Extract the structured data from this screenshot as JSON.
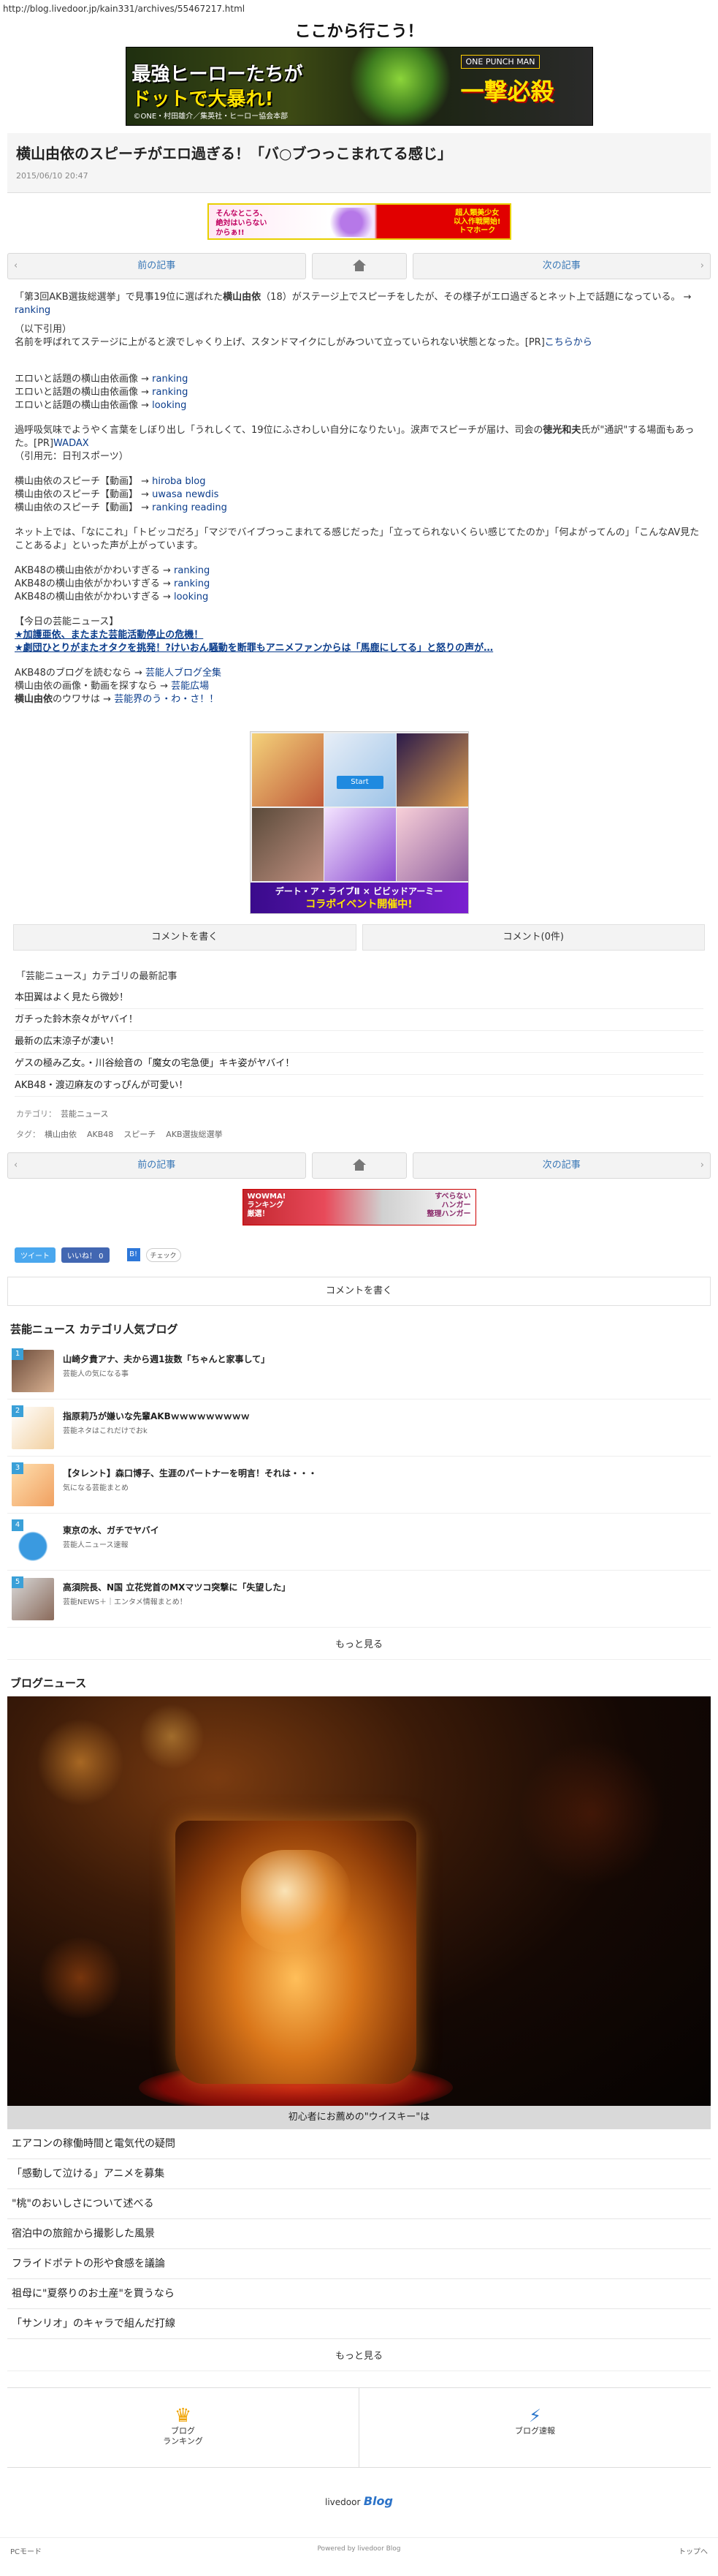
{
  "browser": {
    "url": "http://blog.livedoor.jp/kain331/archives/55467217.html"
  },
  "site": {
    "title": "ここから行こう！"
  },
  "banner": {
    "line1a": "最強ヒーローたちが",
    "line2a": "ドットで大暴れ!",
    "credit": "©ONE・村田雄介／集英社・ヒーロー協会本部",
    "brand": "ONE PUNCH MAN",
    "logo": "一撃必殺"
  },
  "article": {
    "title": "横山由依のスピーチがエロ過ぎる！「バ○ブつっこまれてる感じ」",
    "date": "2015/06/10 20:47"
  },
  "ad_small": {
    "left": "そんなところ、\n絶対はいらない\nからぁ!!",
    "right": "超人類美少女\n以入作戦開始!\nトマホーク"
  },
  "pager": {
    "prev": "前の記事",
    "next": "次の記事",
    "prev_arrow": "‹",
    "next_arrow": "›"
  },
  "body": {
    "p1a": "「第3回AKB選抜総選挙」で見事19位に選ばれた",
    "p1b": "横山由依",
    "p1c": "（18）がステージ上でスピーチをしたが、その様子がエロ過ぎるとネット上で話題になっている。 → ",
    "p1link": "ranking",
    "p2": "（以下引用）",
    "p3a": "名前を呼ばれてステージに上がると涙でしゃくり上げ、スタンドマイクにしがみついて立っていられない状態となった。[PR]",
    "p3link": "こちらから",
    "img1": "エロいと話題の横山由依画像 → ",
    "img1link": "ranking",
    "img2": "エロいと話題の横山由依画像 → ",
    "img2link": "ranking",
    "img3": "エロいと話題の横山由依画像 → ",
    "img3link": "looking",
    "p4a": "過呼吸気味でようやく言葉をしぼり出し「うれしくて、19位にふさわしい自分になりたい」。涙声でスピーチが届け、司会の",
    "p4b": "徳光和夫",
    "p4c": "氏が\"通訳\"する場面もあった。[PR]",
    "p4link": "WADAX",
    "p5": "（引用元：日刊スポーツ）",
    "v1": "横山由依のスピーチ【動画】 → ",
    "v1l1": "hiroba",
    "v1l2": "blog",
    "v2": "横山由依のスピーチ【動画】 → ",
    "v2l1": "uwasa",
    "v2l2": "newdis",
    "v3": "横山由依のスピーチ【動画】 → ",
    "v3l1": "ranking",
    "v3l2": "reading",
    "p6": "ネット上では、「なにこれ」「トビッコだろ」「マジでバイブつっこまれてる感じだった」「立ってられないくらい感じてたのか」「何よがってんの」「こんなAV見たことあるよ」といった声が上がっています。",
    "a1": "AKB48の横山由依がかわいすぎる → ",
    "a1l": "ranking",
    "a2": "AKB48の横山由依がかわいすぎる → ",
    "a2l": "ranking",
    "a3": "AKB48の横山由依がかわいすぎる → ",
    "a3l": "looking",
    "today": "【今日の芸能ニュース】",
    "t1": "★加護亜依、またまた芸能活動停止の危機！",
    "t2": "★劇団ひとりがまたオタクを挑発！?けいおん騒動を断罪もアニメファンからは「馬鹿にしてる」と怒りの声が…",
    "r1": "AKB48のブログを読むなら → ",
    "r1l": "芸能人ブログ全集",
    "r2": "横山由依の画像・動画を探すなら → ",
    "r2l": "芸能広場",
    "r3a": "横山由依",
    "r3b": "のウワサは → ",
    "r3l": "芸能界のう・わ・さ！！"
  },
  "ad_grid": {
    "start": "Start",
    "strip1": "デート・ア・ライブⅡ × ビビッドアーミー",
    "strip2": "コラボイベント開催中!"
  },
  "comments": {
    "write": "コメントを書く",
    "count": "コメント(0件)"
  },
  "category": {
    "heading": "「芸能ニュース」カテゴリの最新記事",
    "items": [
      "本田翼はよく見たら微妙！",
      "ガチった鈴木奈々がヤバイ！",
      "最新の広末涼子が凄い！",
      "ゲスの極み乙女。・川谷絵音の「魔女の宅急便」キキ姿がヤバイ！",
      "AKB48・渡辺麻友のすっぴんが可愛い！"
    ],
    "cat_label": "カテゴリ：",
    "cat_value": "芸能ニュース",
    "tag_label": "タグ：",
    "tags": [
      "横山由依",
      "AKB48",
      "スピーチ",
      "AKB選抜総選挙"
    ]
  },
  "ad_wide": {
    "left": "WOWMA!\nランキング\n厳選！",
    "right": "すべらない\nハンガー\n整理ハンガー"
  },
  "social": {
    "tweet": "ツイート",
    "like": "いいね！ 0",
    "hatena": "B!",
    "check": "チェック"
  },
  "comment_bar": "コメントを書く",
  "popular": {
    "title": "芸能ニュース カテゴリ人気ブログ",
    "items": [
      {
        "n": "1",
        "title": "山崎夕貴アナ、夫から週1抜数「ちゃんと家事して」",
        "sub": "芸能人の気になる事"
      },
      {
        "n": "2",
        "title": "指原莉乃が嫌いな先輩AKBｗｗｗｗｗｗｗｗｗ",
        "sub": "芸能ネタはこれだけでおk"
      },
      {
        "n": "3",
        "title": "【タレント】森口博子、生涯のパートナーを明言！それは・・・",
        "sub": "気になる芸能まとめ"
      },
      {
        "n": "4",
        "title": "東京の水、ガチでヤバイ",
        "sub": "芸能人ニュース速報"
      },
      {
        "n": "5",
        "title": "高須院長、N国 立花党首のMXマツコ突撃に「失望した」",
        "sub": "芸能NEWS＋｜エンタメ情報まとめ！"
      }
    ],
    "more": "もっと見る"
  },
  "blognews": {
    "title": "ブログニュース",
    "caption": "初心者にお薦めの\"ウイスキー\"は",
    "items": [
      "エアコンの稼働時間と電気代の疑問",
      "「感動して泣ける」アニメを募集",
      "\"桃\"のおいしさについて述べる",
      "宿泊中の旅館から撮影した風景",
      "フライドポテトの形や食感を議論",
      "祖母に\"夏祭りのお土産\"を買うなら",
      "「サンリオ」のキャラで組んだ打線"
    ],
    "more": "もっと見る"
  },
  "footer": {
    "tile1a": "ブログ",
    "tile1b": "ランキング",
    "tile2": "ブログ速報",
    "logo_ld": "livedoor",
    "logo_blog": "Blog",
    "pc": "PCモード",
    "powered": "Powered by livedoor Blog",
    "top": "トップへ"
  }
}
